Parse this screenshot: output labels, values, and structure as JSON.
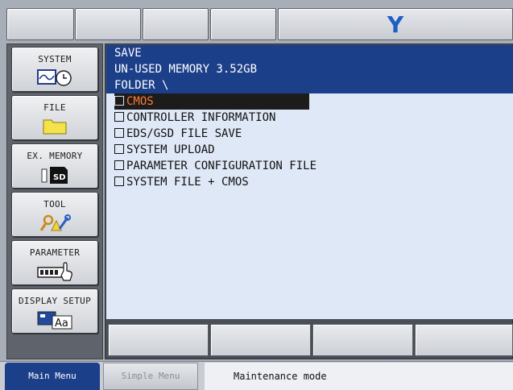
{
  "brand": {
    "logo_text": "Y"
  },
  "left_menu": [
    {
      "label": "SYSTEM",
      "icon": "system-clock-icon"
    },
    {
      "label": "FILE",
      "icon": "folder-icon"
    },
    {
      "label": "EX. MEMORY",
      "icon": "sd-card-icon"
    },
    {
      "label": "TOOL",
      "icon": "tool-wrench-icon"
    },
    {
      "label": "PARAMETER",
      "icon": "parameter-hand-icon"
    },
    {
      "label": "DISPLAY SETUP",
      "icon": "display-font-icon"
    }
  ],
  "content": {
    "title": "SAVE",
    "memory_line": "UN-USED MEMORY  3.52GB",
    "folder_line": "FOLDER \\",
    "items": [
      {
        "label": "CMOS",
        "selected": true
      },
      {
        "label": "CONTROLLER INFORMATION",
        "selected": false
      },
      {
        "label": "EDS/GSD FILE SAVE",
        "selected": false
      },
      {
        "label": "SYSTEM UPLOAD",
        "selected": false
      },
      {
        "label": "PARAMETER CONFIGURATION FILE",
        "selected": false
      },
      {
        "label": "SYSTEM FILE + CMOS",
        "selected": false
      }
    ]
  },
  "bottom": {
    "main_menu": "Main Menu",
    "simple_menu": "Simple Menu",
    "status": "Maintenance mode"
  },
  "colors": {
    "header_blue": "#1c3f8a",
    "body_bg": "#dfe8f7",
    "selection_text": "#ff7a30",
    "brand_blue": "#1f5fc4"
  }
}
